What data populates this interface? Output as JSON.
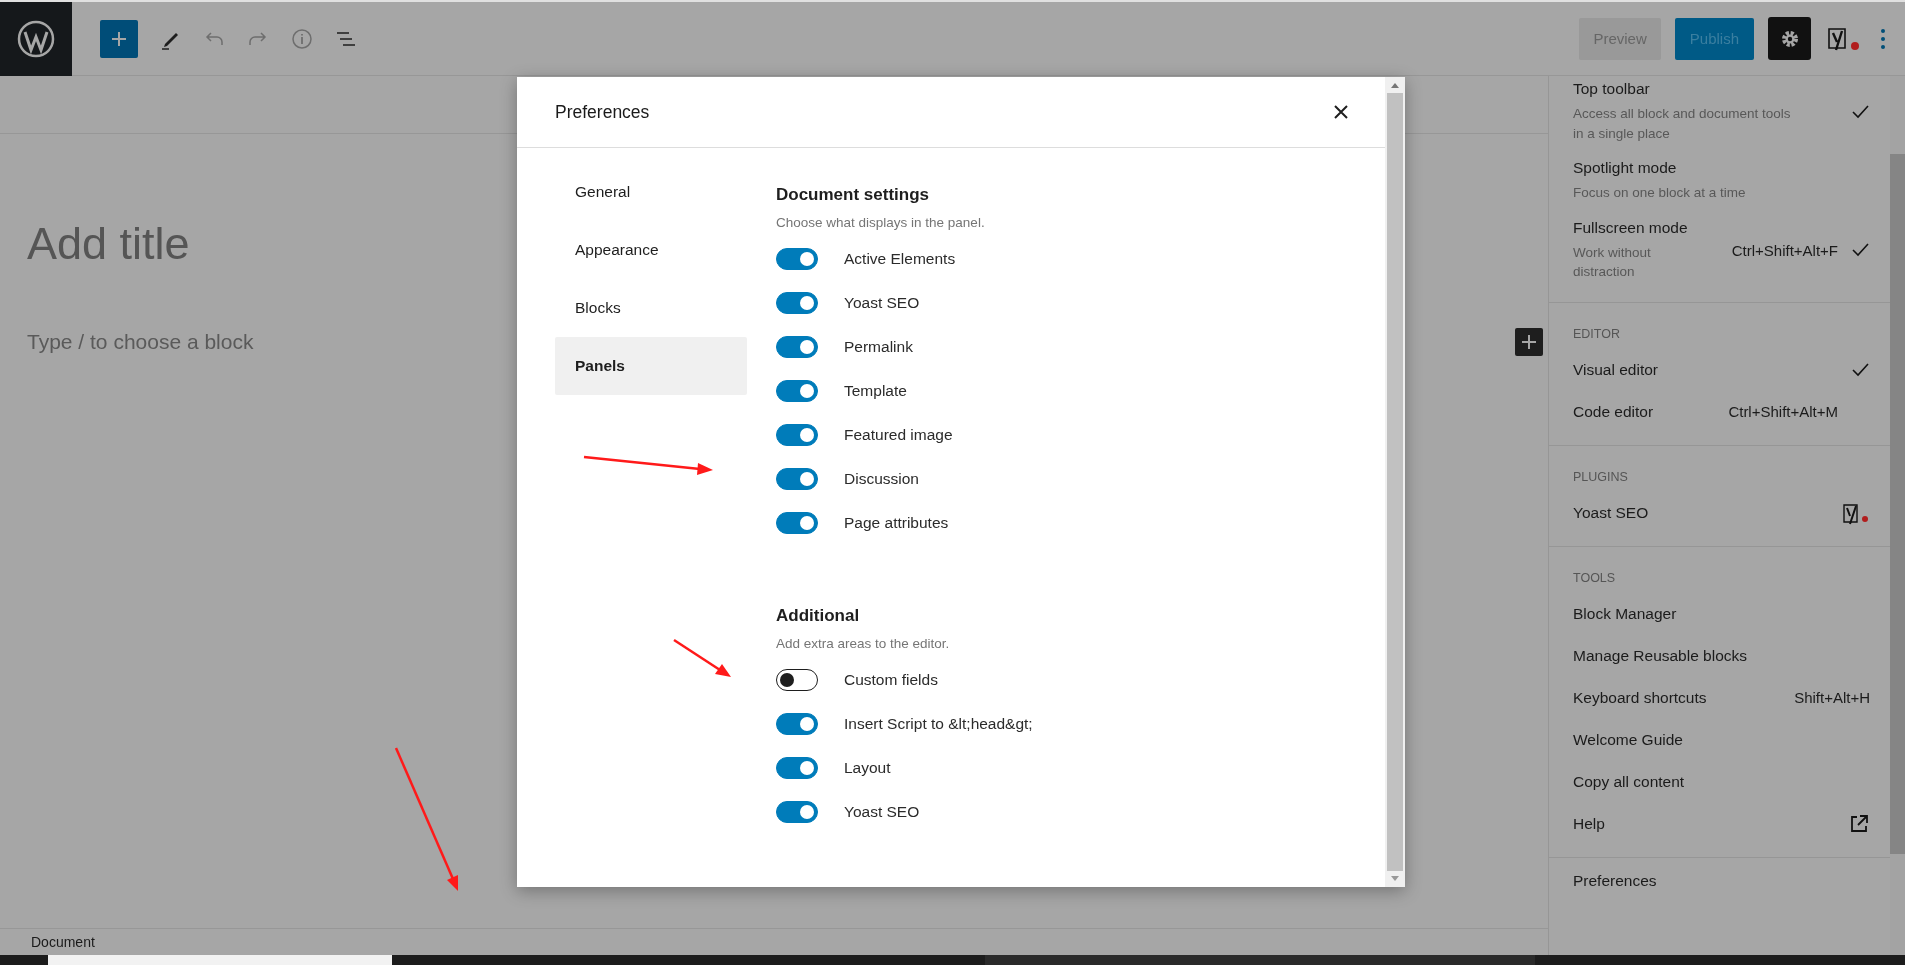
{
  "toolbar": {
    "preview": "Preview",
    "publish": "Publish"
  },
  "editor": {
    "title_placeholder": "Add title",
    "block_placeholder": "Type / to choose a block"
  },
  "footer": {
    "breadcrumb": "Document"
  },
  "options_menu": {
    "sections": [
      {
        "items": [
          {
            "kind": "toggle",
            "label": "Top toolbar",
            "description": "Access all block and document tools in a single place",
            "checked": true
          },
          {
            "kind": "toggle",
            "label": "Spotlight mode",
            "description": "Focus on one block at a time",
            "checked": false
          },
          {
            "kind": "toggle",
            "label": "Fullscreen mode",
            "description": "Work without distraction",
            "shortcut": "Ctrl+Shift+Alt+F",
            "checked": true
          }
        ]
      },
      {
        "heading": "EDITOR",
        "items": [
          {
            "kind": "toggle",
            "label": "Visual editor",
            "checked": true
          },
          {
            "kind": "toggle",
            "label": "Code editor",
            "shortcut": "Ctrl+Shift+Alt+M",
            "checked": false
          }
        ]
      },
      {
        "heading": "PLUGINS",
        "items": [
          {
            "kind": "plugin",
            "label": "Yoast SEO"
          }
        ]
      },
      {
        "heading": "TOOLS",
        "items": [
          {
            "kind": "action",
            "label": "Block Manager"
          },
          {
            "kind": "action",
            "label": "Manage Reusable blocks"
          },
          {
            "kind": "action",
            "label": "Keyboard shortcuts",
            "shortcut": "Shift+Alt+H"
          },
          {
            "kind": "action",
            "label": "Welcome Guide"
          },
          {
            "kind": "action",
            "label": "Copy all content"
          },
          {
            "kind": "link",
            "label": "Help"
          }
        ]
      },
      {
        "items": [
          {
            "kind": "action",
            "label": "Preferences"
          }
        ]
      }
    ]
  },
  "modal": {
    "title": "Preferences",
    "tabs": [
      {
        "label": "General",
        "selected": false
      },
      {
        "label": "Appearance",
        "selected": false
      },
      {
        "label": "Blocks",
        "selected": false
      },
      {
        "label": "Panels",
        "selected": true
      }
    ],
    "sections": [
      {
        "title": "Document settings",
        "description": "Choose what displays in the panel.",
        "options": [
          {
            "label": "Active Elements",
            "on": true
          },
          {
            "label": "Yoast SEO",
            "on": true
          },
          {
            "label": "Permalink",
            "on": true
          },
          {
            "label": "Template",
            "on": true
          },
          {
            "label": "Featured image",
            "on": true
          },
          {
            "label": "Discussion",
            "on": true
          },
          {
            "label": "Page attributes",
            "on": true
          }
        ]
      },
      {
        "title": "Additional",
        "description": "Add extra areas to the editor.",
        "options": [
          {
            "label": "Custom fields",
            "on": false
          },
          {
            "label": "Insert Script to &lt;head&gt;",
            "on": true
          },
          {
            "label": "Layout",
            "on": true
          },
          {
            "label": "Yoast SEO",
            "on": true
          }
        ]
      }
    ]
  }
}
